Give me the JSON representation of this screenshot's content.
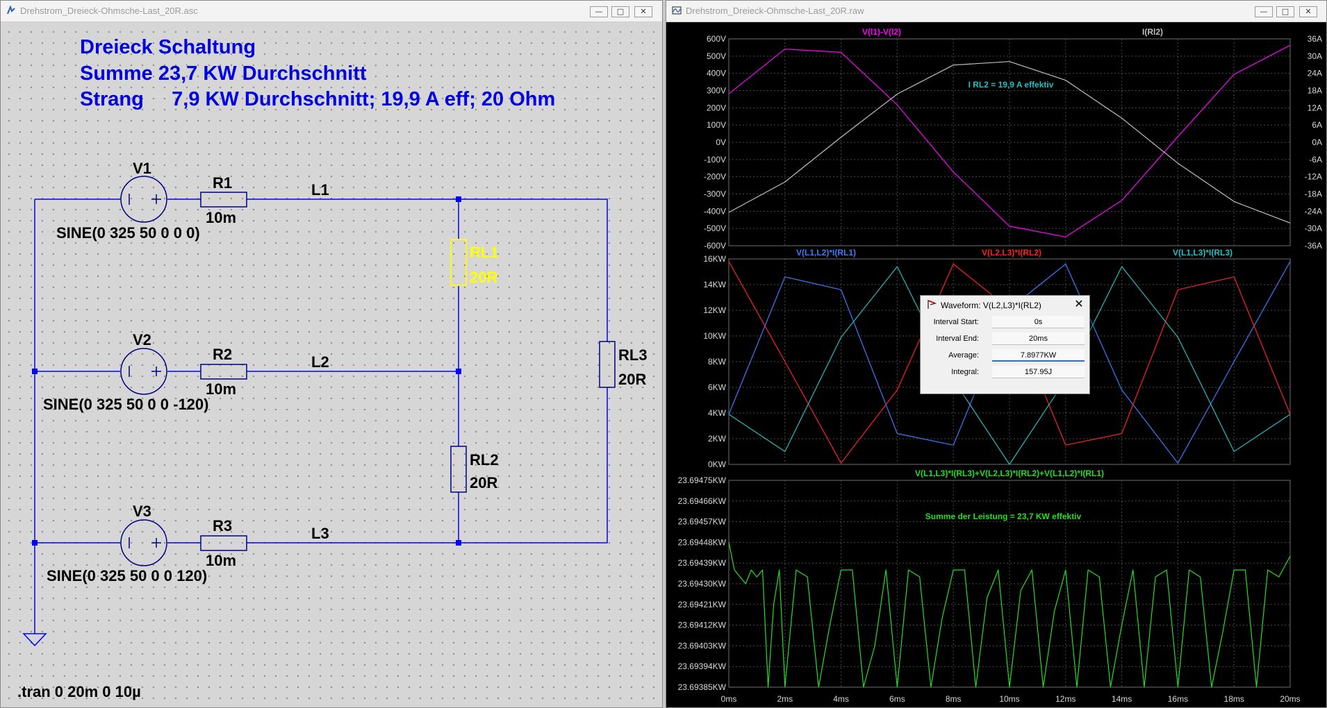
{
  "schematic": {
    "title": "Drehstrom_Dreieck-Ohmsche-Last_20R.asc",
    "heading_line1": "Dreieck Schaltung",
    "heading_line2": "Summe 23,7 KW Durchschnitt",
    "heading_line3": "Strang     7,9 KW Durchschnitt; 19,9 A eff; 20 Ohm",
    "sources": [
      {
        "name": "V1",
        "spec": "SINE(0 325 50 0 0 0)"
      },
      {
        "name": "V2",
        "spec": "SINE(0 325 50 0 0 -120)"
      },
      {
        "name": "V3",
        "spec": "SINE(0 325 50 0 0 120)"
      }
    ],
    "resistors": [
      {
        "name": "R1",
        "value": "10m"
      },
      {
        "name": "R2",
        "value": "10m"
      },
      {
        "name": "R3",
        "value": "10m"
      }
    ],
    "lines": [
      "L1",
      "L2",
      "L3"
    ],
    "loads": [
      {
        "name": "RL1",
        "value": "20R"
      },
      {
        "name": "RL2",
        "value": "20R"
      },
      {
        "name": "RL3",
        "value": "20R"
      }
    ],
    "directive": ".tran 0 20m 0 10µ",
    "colors": {
      "wire": "#0000ff",
      "comp": "#000080",
      "text": "#0000ff",
      "highlight": "#ffff00"
    }
  },
  "plot_window": {
    "title": "Drehstrom_Dreieck-Ohmsche-Last_20R.raw",
    "x_ticks": [
      "0ms",
      "2ms",
      "4ms",
      "6ms",
      "8ms",
      "10ms",
      "12ms",
      "14ms",
      "16ms",
      "18ms",
      "20ms"
    ]
  },
  "chart_data": [
    {
      "type": "line",
      "x": [
        0,
        2,
        4,
        6,
        8,
        10,
        12,
        14,
        16,
        18,
        20
      ],
      "y_ticks": [
        "600V",
        "500V",
        "400V",
        "300V",
        "200V",
        "100V",
        "0V",
        "-100V",
        "-200V",
        "-300V",
        "-400V",
        "-500V",
        "-600V"
      ],
      "y2_ticks": [
        "36A",
        "30A",
        "24A",
        "18A",
        "12A",
        "6A",
        "0A",
        "-6A",
        "-12A",
        "-18A",
        "-24A",
        "-30A",
        "-36A"
      ],
      "ylim": [
        -600,
        600
      ],
      "y2lim": [
        -36,
        36
      ],
      "annotation": "I RL2 = 19,9 A effektiv",
      "series": [
        {
          "name": "V(l1)-V(l2)",
          "color": "#ff00ff",
          "values": [
            281,
            541,
            522,
            217,
            -172,
            -487,
            -549,
            -338,
            33,
            394,
            563
          ]
        },
        {
          "name": "I(Rl2)",
          "color": "#c0c0c0",
          "axis": "right",
          "values": [
            -24.4,
            -13.8,
            1.8,
            16.8,
            26.9,
            28.1,
            21.6,
            8.4,
            -7.3,
            -20.6,
            -28.1
          ]
        }
      ]
    },
    {
      "type": "line",
      "x": [
        0,
        2,
        4,
        6,
        8,
        10,
        12,
        14,
        16,
        18,
        20
      ],
      "y_ticks": [
        "16KW",
        "14KW",
        "12KW",
        "10KW",
        "8KW",
        "6KW",
        "4KW",
        "2KW",
        "0KW"
      ],
      "ylim": [
        0,
        16
      ],
      "series": [
        {
          "name": "V(L1,L2)*I(RL1)",
          "color": "#3a7cff",
          "values": [
            3.9,
            14.6,
            13.6,
            2.4,
            1.5,
            12.1,
            15.6,
            5.8,
            0.1,
            8.0,
            15.8
          ]
        },
        {
          "name": "V(L2,L3)*I(RL2)",
          "color": "#ff2020",
          "values": [
            15.8,
            8.0,
            0.1,
            5.8,
            15.6,
            12.1,
            1.5,
            2.4,
            13.6,
            14.6,
            3.9
          ]
        },
        {
          "name": "V(L1,L3)*I(RL3)",
          "color": "#20c0c0",
          "values": [
            3.9,
            1.0,
            9.9,
            15.4,
            6.6,
            0.0,
            6.6,
            15.4,
            9.9,
            1.0,
            3.9
          ]
        }
      ]
    },
    {
      "type": "line",
      "x": [
        0,
        0.2,
        0.4,
        0.6,
        0.8,
        1.0,
        1.2,
        1.4,
        1.6,
        1.8,
        2.0,
        2.4,
        2.8,
        3.2,
        3.6,
        4.0,
        4.4,
        4.8,
        5.2,
        5.6,
        6.0,
        6.4,
        6.8,
        7.2,
        7.6,
        8.0,
        8.4,
        8.8,
        9.2,
        9.6,
        10.0,
        10.4,
        10.8,
        11.2,
        11.6,
        12.0,
        12.4,
        12.8,
        13.2,
        13.6,
        14.0,
        14.4,
        14.8,
        15.2,
        15.6,
        16.0,
        16.4,
        16.8,
        17.2,
        17.6,
        18.0,
        18.4,
        18.8,
        19.2,
        19.6,
        20.0
      ],
      "y_ticks": [
        "23.69475KW",
        "23.69466KW",
        "23.69457KW",
        "23.69448KW",
        "23.69439KW",
        "23.69430KW",
        "23.69421KW",
        "23.69412KW",
        "23.69403KW",
        "23.69394KW",
        "23.69385KW"
      ],
      "ylim": [
        23.69385,
        23.69475
      ],
      "title": "V(L1,L3)*I(RL3)+V(L2,L3)*I(RL2)+V(L1,L2)*I(RL1)",
      "annotation": "Summe der Leistung = 23,7 KW effektiv",
      "series": [
        {
          "name": "V(L1,L3)*I(RL3)+V(L2,L3)*I(RL2)+V(L1,L2)*I(RL1)",
          "color": "#20e020",
          "values": [
            23.69448,
            23.69436,
            23.69433,
            23.6943,
            23.69436,
            23.69433,
            23.69436,
            23.69385,
            23.69421,
            23.69436,
            23.69385,
            23.69436,
            23.69433,
            23.69385,
            23.69412,
            23.69436,
            23.69436,
            23.69385,
            23.69403,
            23.69436,
            23.69385,
            23.69436,
            23.69433,
            23.69385,
            23.69415,
            23.69436,
            23.69436,
            23.69385,
            23.69424,
            23.69436,
            23.69385,
            23.69427,
            23.69436,
            23.69385,
            23.69418,
            23.69436,
            23.69385,
            23.69436,
            23.69433,
            23.69385,
            23.69412,
            23.69436,
            23.69385,
            23.69433,
            23.69436,
            23.69385,
            23.69436,
            23.69433,
            23.69385,
            23.69409,
            23.69436,
            23.69436,
            23.69385,
            23.69436,
            23.69433,
            23.69442
          ]
        }
      ]
    }
  ],
  "dialog": {
    "title": "Waveform: V(L2,L3)*I(RL2)",
    "rows": [
      {
        "label": "Interval Start:",
        "value": "0s"
      },
      {
        "label": "Interval End:",
        "value": "20ms"
      },
      {
        "label": "Average:",
        "value": "7.8977KW"
      },
      {
        "label": "Integral:",
        "value": "157.95J"
      }
    ]
  }
}
